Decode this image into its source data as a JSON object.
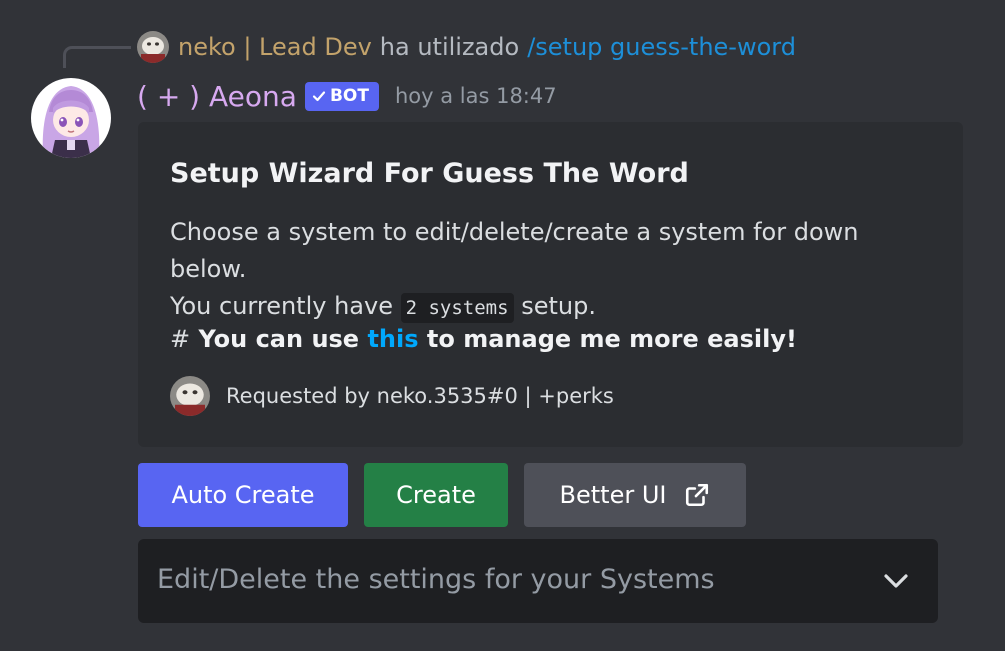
{
  "reply": {
    "author": "neko | Lead Dev",
    "action": "ha utilizado",
    "command": "/setup guess-the-word"
  },
  "message": {
    "username": "( + ) Aeona",
    "bot_tag": "BOT",
    "timestamp": "hoy a las 18:47"
  },
  "embed": {
    "title": "Setup Wizard For Guess The Word",
    "desc_line1": "Choose a system to edit/delete/create a system for down below.",
    "desc_line2_pre": "You currently have",
    "desc_code": "2 systems",
    "desc_line2_post": "setup.",
    "heading_hash": "#",
    "heading_pre": "You can use",
    "heading_link": "this",
    "heading_post": "to manage me more easily!",
    "footer": "Requested by neko.3535#0 | +perks"
  },
  "buttons": {
    "auto_create": "Auto Create",
    "create": "Create",
    "better_ui": "Better UI"
  },
  "select": {
    "placeholder": "Edit/Delete the settings for your Systems"
  },
  "colors": {
    "background": "#313338",
    "embed": "#2b2d31",
    "blurple": "#5865f2",
    "green": "#248046",
    "grey": "#4e5058",
    "link": "#00a8fc",
    "username": "#d7a9f0",
    "reply_name": "#c3a36b"
  }
}
